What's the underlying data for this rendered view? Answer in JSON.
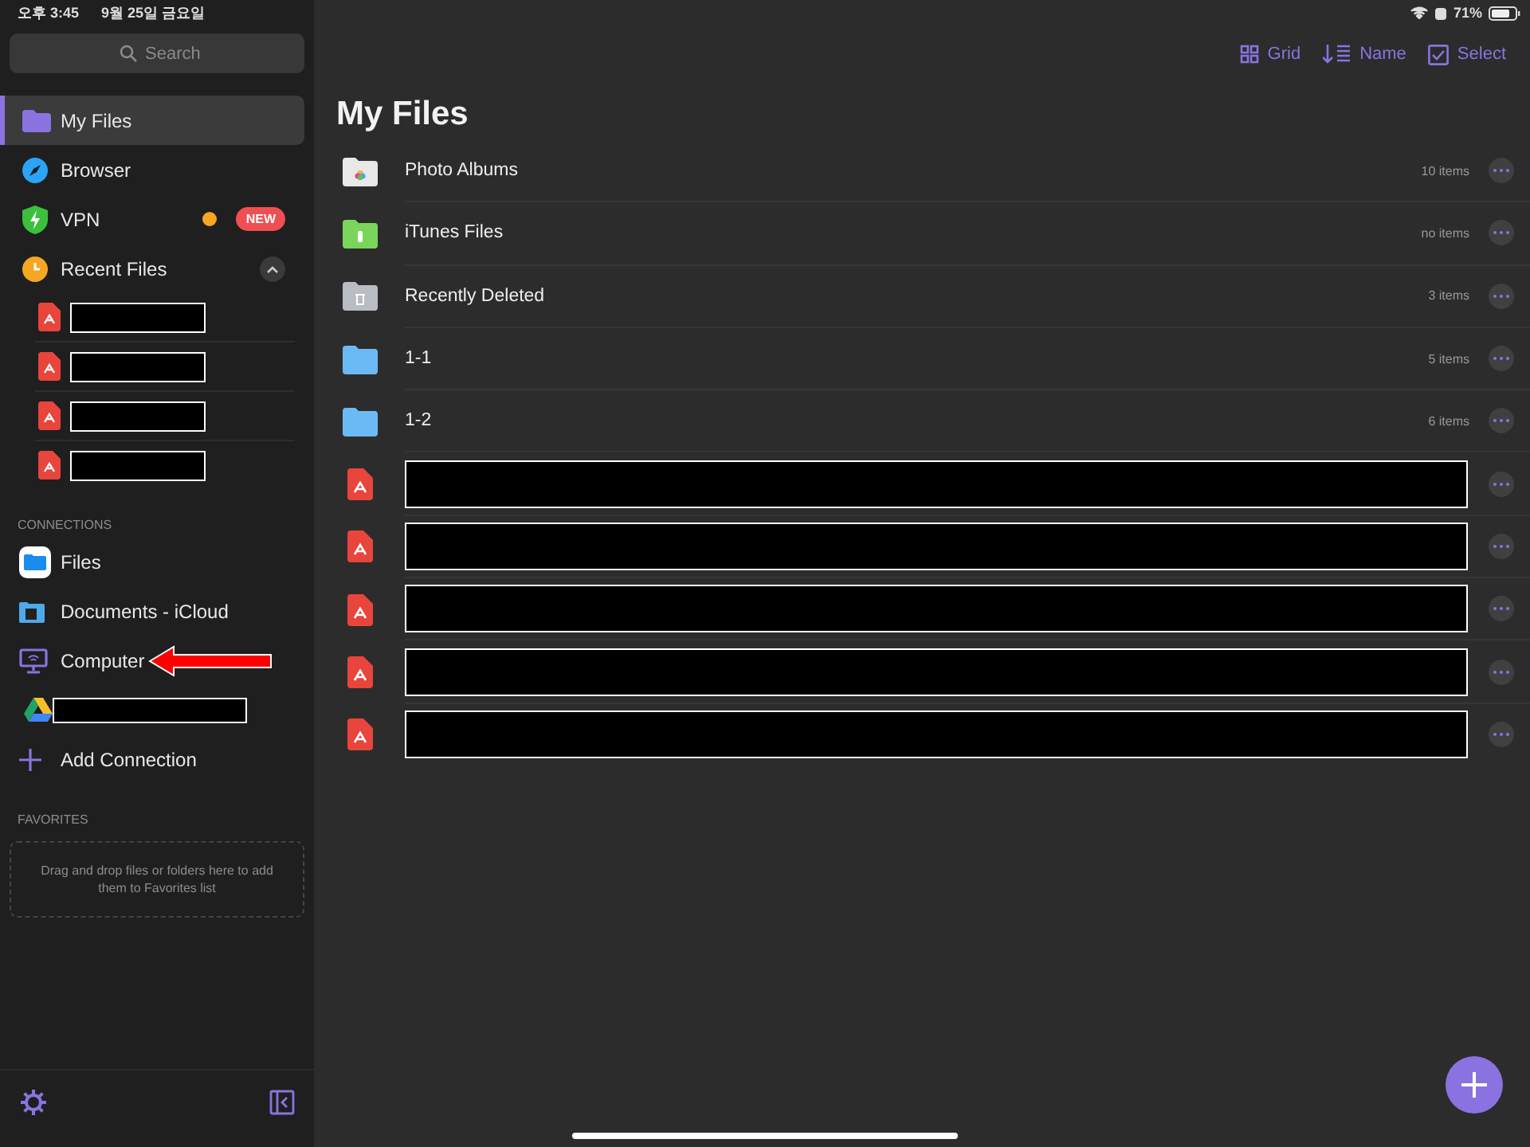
{
  "status_bar": {
    "time": "오후 3:45",
    "date": "9월 25일 금요일",
    "battery": "71%"
  },
  "sidebar": {
    "search": {
      "placeholder": "Search"
    },
    "items": [
      {
        "kind": "folder",
        "label": "My Files",
        "selected": true,
        "status_dot": false
      },
      {
        "kind": "browser",
        "label": "Browser",
        "selected": false,
        "status_dot": false
      },
      {
        "kind": "vpn",
        "label": "VPN",
        "selected": false,
        "status_dot": true,
        "badge": "NEW"
      },
      {
        "kind": "recent",
        "label": "Recent Files",
        "selected": false,
        "status_dot": false,
        "expanded": true
      }
    ],
    "recent_files": [
      {
        "kind": "pdf"
      },
      {
        "kind": "pdf"
      },
      {
        "kind": "pdf"
      },
      {
        "kind": "pdf"
      }
    ],
    "connections": {
      "heading": "CONNECTIONS",
      "items": [
        {
          "kind": "files",
          "label": "Files",
          "annotated": false
        },
        {
          "kind": "icloud",
          "label": "Documents - iCloud",
          "annotated": false
        },
        {
          "kind": "computer",
          "label": "Computer",
          "annotated": true
        },
        {
          "kind": "drive",
          "annotated": false
        },
        {
          "kind": "add",
          "label": "Add Connection",
          "annotated": false
        }
      ]
    },
    "favorites": {
      "heading": "FAVORITES",
      "hint": "Drag and drop files or folders here to add them to Favorites list"
    }
  },
  "main": {
    "toolbar": [
      {
        "kind": "grid",
        "label": "Grid"
      },
      {
        "kind": "sort",
        "label": "Name"
      },
      {
        "kind": "select",
        "label": "Select"
      }
    ],
    "title": "My Files",
    "rows": [
      {
        "kind": "photos",
        "name": "Photo Albums",
        "count": "10 items"
      },
      {
        "kind": "itunes",
        "name": "iTunes Files",
        "count": "no items"
      },
      {
        "kind": "trash",
        "name": "Recently Deleted",
        "count": "3 items"
      },
      {
        "kind": "folder",
        "name": "1-1",
        "count": "5 items"
      },
      {
        "kind": "folder",
        "name": "1-2",
        "count": "6 items"
      },
      {
        "kind": "pdf"
      },
      {
        "kind": "pdf"
      },
      {
        "kind": "pdf"
      },
      {
        "kind": "pdf"
      },
      {
        "kind": "pdf"
      }
    ]
  }
}
